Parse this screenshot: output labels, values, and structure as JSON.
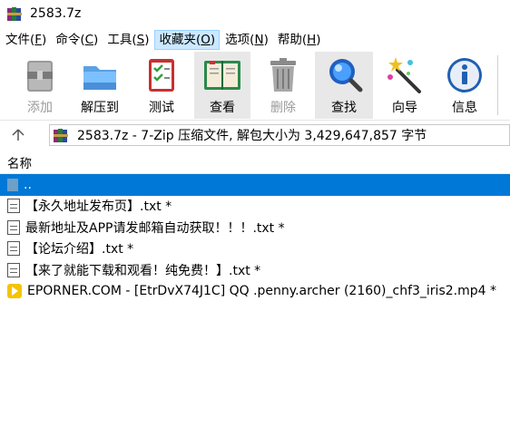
{
  "window": {
    "title": "2583.7z",
    "app_icon": "winrar-books-icon"
  },
  "menu": [
    {
      "label": "文件(",
      "key": "F",
      "tail": ")"
    },
    {
      "label": "命令(",
      "key": "C",
      "tail": ")"
    },
    {
      "label": "工具(",
      "key": "S",
      "tail": ")"
    },
    {
      "label": "收藏夹(",
      "key": "O",
      "tail": ")"
    },
    {
      "label": "选项(",
      "key": "N",
      "tail": ")"
    },
    {
      "label": "帮助(",
      "key": "H",
      "tail": ")"
    }
  ],
  "toolbar": {
    "add": {
      "label": "添加",
      "icon": "archive-add-icon",
      "disabled": true
    },
    "extract": {
      "label": "解压到",
      "icon": "extract-folder-icon"
    },
    "test": {
      "label": "测试",
      "icon": "test-checklist-icon"
    },
    "view": {
      "label": "查看",
      "icon": "open-book-icon"
    },
    "delete": {
      "label": "删除",
      "icon": "trash-can-icon",
      "disabled": true
    },
    "find": {
      "label": "查找",
      "icon": "magnifier-icon"
    },
    "wizard": {
      "label": "向导",
      "icon": "magic-wand-icon"
    },
    "info": {
      "label": "信息",
      "icon": "info-icon"
    }
  },
  "pathbar": {
    "text": "2583.7z - 7-Zip 压缩文件, 解包大小为 3,429,647,857 字节",
    "up_icon": "up-arrow-icon"
  },
  "filelist": {
    "column_name": "名称",
    "rows": [
      {
        "name": "..",
        "icon": "folder-up-icon",
        "selected": true
      },
      {
        "name": "【永久地址发布页】.txt *",
        "icon": "text-file-icon"
      },
      {
        "name": "最新地址及APP请发邮箱自动获取！！！.txt *",
        "icon": "text-file-icon"
      },
      {
        "name": "【论坛介绍】.txt *",
        "icon": "text-file-icon"
      },
      {
        "name": "【来了就能下载和观看！纯免费！】.txt *",
        "icon": "text-file-icon"
      },
      {
        "name": "EPORNER.COM - [EtrDvX74J1C] QQ .penny.archer (2160)_chf3_iris2.mp4 *",
        "icon": "video-file-icon"
      }
    ]
  },
  "colors": {
    "selection": "#0078d7",
    "menu_highlight": "#cce8ff"
  }
}
